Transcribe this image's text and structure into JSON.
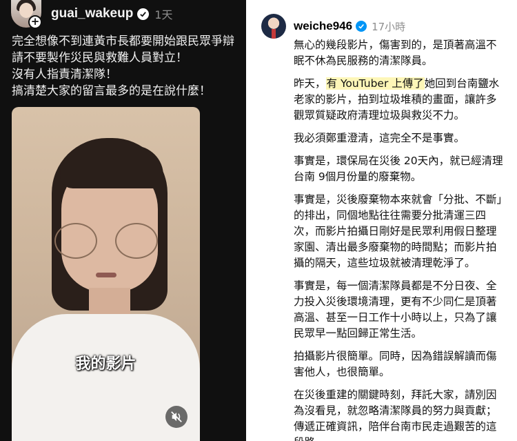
{
  "left_post": {
    "username": "guai_wakeup",
    "time": "1天",
    "caption_lines": [
      "完全想像不到連黃市長都要開始跟民眾爭辯",
      "請不要製作災民與救難人員對立！",
      "沒有人指責清潔隊！",
      "搞清楚大家的留言最多的是在說什麼！"
    ],
    "video": {
      "subtitle": "我的影片",
      "audio_icon": "speaker-muted-icon"
    }
  },
  "right_post": {
    "username": "weiche946",
    "time": "17小時",
    "paragraphs": [
      [
        "無心的幾段影片，傷害到的，是頂著高溫不",
        "眠不休為民服務的清潔隊員。"
      ],
      [
        "昨天，有 YouTuber 上傳了她回到台南鹽水",
        "老家的影片，拍到垃圾堆積的畫面，讓許多",
        "觀眾質疑政府清理垃圾與救災不力。"
      ],
      [
        "我必須鄭重澄清，這完全不是事實。"
      ],
      [
        "事實是，環保局在災後 20天內，就已經清理",
        "台南 9個月份量的廢棄物。"
      ],
      [
        "事實是，災後廢棄物本來就會「分批、不斷」",
        "的排出，同個地點往往需要分批清運三四",
        "次，而影片拍攝日剛好是民眾利用假日整理",
        "家園、清出最多廢棄物的時間點；而影片拍",
        "攝的隔天，這些垃圾就被清理乾淨了。"
      ],
      [
        "事實是，每一個清潔隊員都是不分日夜、全",
        "力投入災後環境清理，更有不少同仁是頂著",
        "高溫、甚至一日工作十小時以上，只為了讓",
        "民眾早一點回歸正常生活。"
      ],
      [
        "拍攝影片很簡單。同時，因為錯誤解讀而傷",
        "害他人，也很簡單。"
      ],
      [
        "在災後重建的關鍵時刻，拜託大家，請別因",
        "為沒看見，就忽略清潔隊員的努力與貢獻；",
        "傳遞正確資訊，陪伴台南市民走過艱苦的這",
        "段路。"
      ]
    ],
    "highlight": {
      "prefix": "昨天，",
      "text": "有 YouTuber 上傳了",
      "suffix": "她回到台南鹽水"
    }
  },
  "colors": {
    "dark_bg": "#101010",
    "verified_blue": "#0095f6",
    "highlight": "#fdf6b8"
  }
}
